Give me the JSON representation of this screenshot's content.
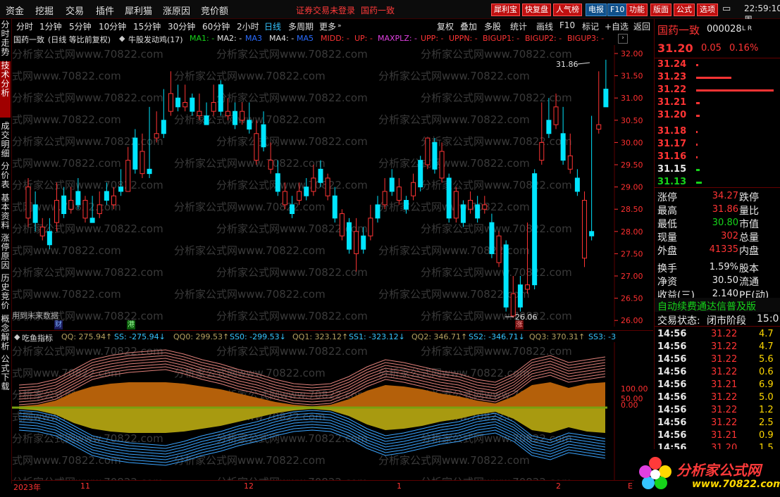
{
  "menu": [
    "资金",
    "挖掘",
    "交易",
    "插件",
    "犀利猫",
    "涨原因",
    "竞价额"
  ],
  "login_notice": "证券交易未登录",
  "menu_stock": "国药一致",
  "toolbar_buttons": [
    "犀利宝",
    "快复盘",
    "人气榜",
    "电报",
    "F10",
    "功能",
    "版面",
    "公式",
    "选项"
  ],
  "clock": "22:59:10 周",
  "left_tabs": [
    "分时走势",
    "技术分析",
    "成交明细",
    "分价表",
    "基本资料",
    "涨停原因",
    "历史竞价",
    "概念解析",
    "公式下载"
  ],
  "periods": [
    "分时",
    "1分钟",
    "5分钟",
    "10分钟",
    "15分钟",
    "30分钟",
    "60分钟",
    "2小时",
    "日线",
    "多周期",
    "更多"
  ],
  "selected_period": "日线",
  "chart_buttons": [
    "复权",
    "叠加",
    "多股",
    "统计",
    "画线",
    "F10",
    "标记",
    "+自选",
    "返回"
  ],
  "chart_header": {
    "name": "国药一致",
    "mode": "(日线 等比前复权)",
    "indicator": "牛股发动鸡(17)",
    "items": [
      "MA1: -",
      "MA2: -",
      "MA3",
      "MA4: -",
      "MA5",
      "MIDD: -",
      "UP: -",
      "MAXPLZ: -",
      "UPP: -",
      "UPPN: -",
      "BIGUP1: -",
      "BIGUP2: -",
      "BIGUP3: -"
    ]
  },
  "main_axis": [
    "32.00",
    "31.50",
    "31.00",
    "30.50",
    "30.00",
    "29.50",
    "29.00",
    "28.50",
    "28.00",
    "27.50",
    "27.00",
    "26.50",
    "26.00"
  ],
  "high_label": "31.86",
  "low_label": "26.06",
  "future_data_note": "用到未来数据",
  "markers": [
    "财",
    "港",
    "涨"
  ],
  "watermark": "分析家公式网www.70822.com",
  "sub_header": {
    "name": "吃鱼指标",
    "items": [
      "QQ: 275.94↑",
      "SS: -275.94↓",
      "QQ0: 299.53↑",
      "SS0: -299.53↓",
      "QQ1: 323.12↑",
      "SS1: -323.12↓",
      "QQ2: 346.71↑",
      "SS2: -346.71↓",
      "QQ3: 370.31↑",
      "SS3: -3"
    ]
  },
  "sub_axis": [
    "100.00",
    "50.00",
    "0.00"
  ],
  "date_axis": [
    "2023年",
    "11",
    "12",
    "1",
    "2",
    "E"
  ],
  "quote": {
    "name": "国药一致",
    "code": "000028",
    "tag": "L R",
    "price": "31.20",
    "change": "0.05",
    "pct": "0.16%"
  },
  "order_book": [
    {
      "price": "31.24",
      "vol": "",
      "bar": 3
    },
    {
      "price": "31.23",
      "vol": "",
      "bar": 50
    },
    {
      "price": "31.22",
      "vol": "",
      "bar": 110
    },
    {
      "price": "31.21",
      "vol": "",
      "bar": 5
    },
    {
      "price": "31.20",
      "vol": "",
      "bar": 5
    },
    {
      "price": "31.18",
      "vol": "",
      "bar": 2
    },
    {
      "price": "31.17",
      "vol": "",
      "bar": 2
    },
    {
      "price": "31.16",
      "vol": "",
      "bar": 2
    },
    {
      "price": "31.15",
      "vol": "",
      "bar": 5
    },
    {
      "price": "31.13",
      "vol": "",
      "bar": 8
    }
  ],
  "stats": [
    {
      "l": "涨停",
      "v": "34.27",
      "r": "跌停"
    },
    {
      "l": "最高",
      "v": "31.86",
      "r": "量比"
    },
    {
      "l": "最低",
      "v": "30.80",
      "r": "市值"
    },
    {
      "l": "现量",
      "v": "302",
      "r": "总量"
    },
    {
      "l": "外盘",
      "v": "41335",
      "r": "内盘"
    },
    {
      "l": "换手",
      "v": "1.59%",
      "r": "股本"
    },
    {
      "l": "净资",
      "v": "30.50",
      "r": "流通"
    },
    {
      "l": "收益(三)",
      "v": "2.140",
      "r": "PE(动)"
    }
  ],
  "ad_banner": "自动续费通达信普及版",
  "trade_status_label": "交易状态:",
  "trade_status": "闭市阶段",
  "trade_status_tail": "15:0",
  "ticks": [
    {
      "t": "14:56",
      "p": "31.22",
      "v": "4.7"
    },
    {
      "t": "14:56",
      "p": "31.22",
      "v": "4.7"
    },
    {
      "t": "14:56",
      "p": "31.22",
      "v": "5.6"
    },
    {
      "t": "14:56",
      "p": "31.22",
      "v": "0.6"
    },
    {
      "t": "14:56",
      "p": "31.21",
      "v": "6.9"
    },
    {
      "t": "14:56",
      "p": "31.22",
      "v": "5.0"
    },
    {
      "t": "14:56",
      "p": "31.22",
      "v": "1.2"
    },
    {
      "t": "14:56",
      "p": "31.22",
      "v": "2.5"
    },
    {
      "t": "14:56",
      "p": "31.21",
      "v": "0.9"
    },
    {
      "t": "14:56",
      "p": "31.20",
      "v": "1.5"
    }
  ],
  "logo_text": "分析家公式网",
  "logo_url": "www.70822.com",
  "colors": {
    "up": "#ff3434",
    "down": "#00e5ff",
    "ma": "#ffffff",
    "bg": "#000000"
  }
}
